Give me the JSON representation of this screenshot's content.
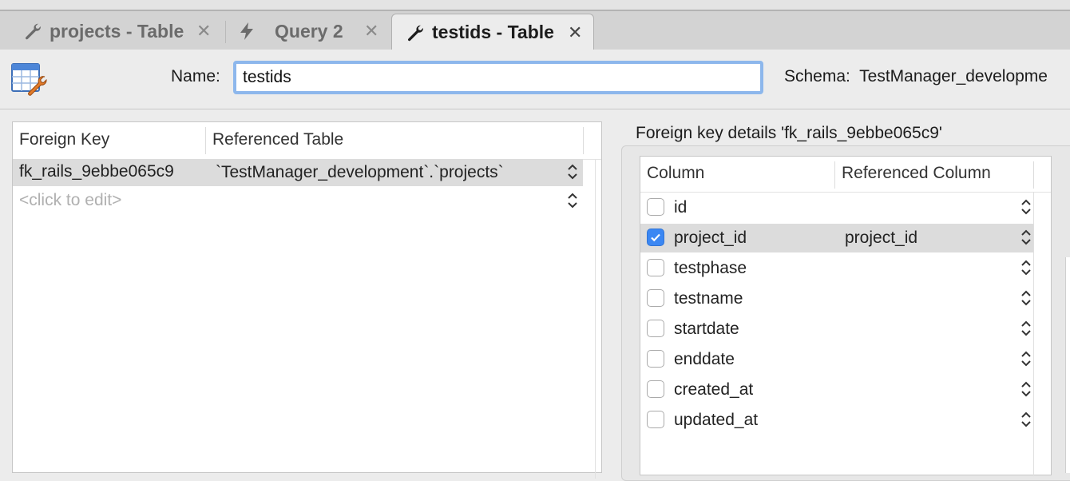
{
  "tabs": [
    {
      "label": "projects - Table",
      "icon": "wrench-icon"
    },
    {
      "label": "Query 2",
      "icon": "lightning-icon"
    },
    {
      "label": "testids - Table",
      "icon": "wrench-icon"
    }
  ],
  "toolbar": {
    "name_label": "Name:",
    "name_value": "testids",
    "schema_label": "Schema:",
    "schema_value": "TestManager_developme"
  },
  "foreign_keys": {
    "headers": [
      "Foreign Key",
      "Referenced Table"
    ],
    "rows": [
      {
        "name": "fk_rails_9ebbe065c9",
        "table": "`TestManager_development`.`projects`"
      }
    ],
    "placeholder": "<click to edit>"
  },
  "details": {
    "title": "Foreign key details 'fk_rails_9ebbe065c9'",
    "headers": [
      "Column",
      "Referenced Column"
    ],
    "rows": [
      {
        "column": "id",
        "checked": false,
        "ref": ""
      },
      {
        "column": "project_id",
        "checked": true,
        "ref": "project_id"
      },
      {
        "column": "testphase",
        "checked": false,
        "ref": ""
      },
      {
        "column": "testname",
        "checked": false,
        "ref": ""
      },
      {
        "column": "startdate",
        "checked": false,
        "ref": ""
      },
      {
        "column": "enddate",
        "checked": false,
        "ref": ""
      },
      {
        "column": "created_at",
        "checked": false,
        "ref": ""
      },
      {
        "column": "updated_at",
        "checked": false,
        "ref": ""
      }
    ]
  },
  "colors": {
    "accent": "#3b87f3",
    "focus_ring": "#8db7ec",
    "selection": "#dcdcdc"
  }
}
